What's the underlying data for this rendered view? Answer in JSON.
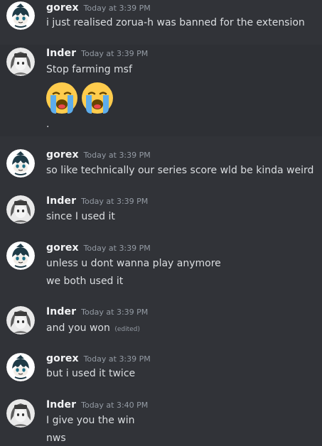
{
  "messages": [
    {
      "author": "gorex",
      "time": "Today at 3:39 PM",
      "lines": [
        "i just realised zorua-h was banned for the extension"
      ]
    },
    {
      "author": "Inder",
      "time": "Today at 3:39 PM",
      "lines": [
        "Stop farming msf",
        "."
      ],
      "emoji": [
        "loudly-crying-face",
        "loudly-crying-face"
      ]
    },
    {
      "author": "gorex",
      "time": "Today at 3:39 PM",
      "lines": [
        "so like technically our series score wld be kinda weird"
      ]
    },
    {
      "author": "Inder",
      "time": "Today at 3:39 PM",
      "lines": [
        "since I used it"
      ]
    },
    {
      "author": "gorex",
      "time": "Today at 3:39 PM",
      "lines": [
        "unless u dont wanna play anymore",
        "we both used it"
      ]
    },
    {
      "author": "Inder",
      "time": "Today at 3:39 PM",
      "lines": [
        "and you won"
      ],
      "edited": "(edited)"
    },
    {
      "author": "gorex",
      "time": "Today at 3:39 PM",
      "lines": [
        "but i used it twice"
      ]
    },
    {
      "author": "Inder",
      "time": "Today at 3:40 PM",
      "lines": [
        "I give you the win",
        "nws"
      ]
    }
  ],
  "colors": {
    "background": "#313338",
    "username": "#f2f3f5",
    "text": "#dbdee1",
    "muted": "#949ba4"
  }
}
